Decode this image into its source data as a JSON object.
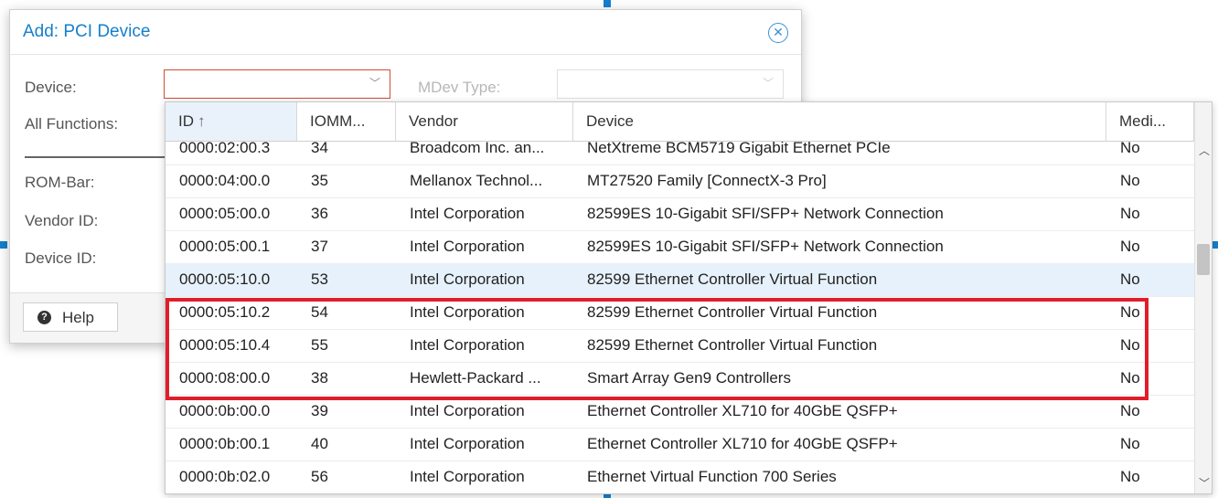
{
  "dialog": {
    "title": "Add: PCI Device",
    "close_icon": "close-circle-icon",
    "labels": {
      "device": "Device:",
      "all_functions": "All Functions:",
      "rom_bar": "ROM-Bar:",
      "vendor_id": "Vendor ID:",
      "device_id": "Device ID:"
    },
    "device_value": "",
    "mdev_label": "MDev Type:",
    "mdev_value": "",
    "help_label": "Help"
  },
  "grid": {
    "columns": [
      "ID",
      "IOMM...",
      "Vendor",
      "Device",
      "Medi..."
    ],
    "sort_indicator": "↑",
    "rows": [
      {
        "id": "0000:02:00.3",
        "iommu": "34",
        "vendor": "Broadcom Inc. an...",
        "device": "NetXtreme BCM5719 Gigabit Ethernet PCIe",
        "mdev": "No"
      },
      {
        "id": "0000:04:00.0",
        "iommu": "35",
        "vendor": "Mellanox Technol...",
        "device": "MT27520 Family [ConnectX-3 Pro]",
        "mdev": "No"
      },
      {
        "id": "0000:05:00.0",
        "iommu": "36",
        "vendor": "Intel Corporation",
        "device": "82599ES 10-Gigabit SFI/SFP+ Network Connection",
        "mdev": "No"
      },
      {
        "id": "0000:05:00.1",
        "iommu": "37",
        "vendor": "Intel Corporation",
        "device": "82599ES 10-Gigabit SFI/SFP+ Network Connection",
        "mdev": "No"
      },
      {
        "id": "0000:05:10.0",
        "iommu": "53",
        "vendor": "Intel Corporation",
        "device": "82599 Ethernet Controller Virtual Function",
        "mdev": "No"
      },
      {
        "id": "0000:05:10.2",
        "iommu": "54",
        "vendor": "Intel Corporation",
        "device": "82599 Ethernet Controller Virtual Function",
        "mdev": "No"
      },
      {
        "id": "0000:05:10.4",
        "iommu": "55",
        "vendor": "Intel Corporation",
        "device": "82599 Ethernet Controller Virtual Function",
        "mdev": "No"
      },
      {
        "id": "0000:08:00.0",
        "iommu": "38",
        "vendor": "Hewlett-Packard ...",
        "device": "Smart Array Gen9 Controllers",
        "mdev": "No"
      },
      {
        "id": "0000:0b:00.0",
        "iommu": "39",
        "vendor": "Intel Corporation",
        "device": "Ethernet Controller XL710 for 40GbE QSFP+",
        "mdev": "No"
      },
      {
        "id": "0000:0b:00.1",
        "iommu": "40",
        "vendor": "Intel Corporation",
        "device": "Ethernet Controller XL710 for 40GbE QSFP+",
        "mdev": "No"
      },
      {
        "id": "0000:0b:02.0",
        "iommu": "56",
        "vendor": "Intel Corporation",
        "device": "Ethernet Virtual Function 700 Series",
        "mdev": "No"
      }
    ],
    "selected_row": "0000:05:10.0",
    "highlight_color": "#e01e2b",
    "accent_color": "#157fcc"
  }
}
